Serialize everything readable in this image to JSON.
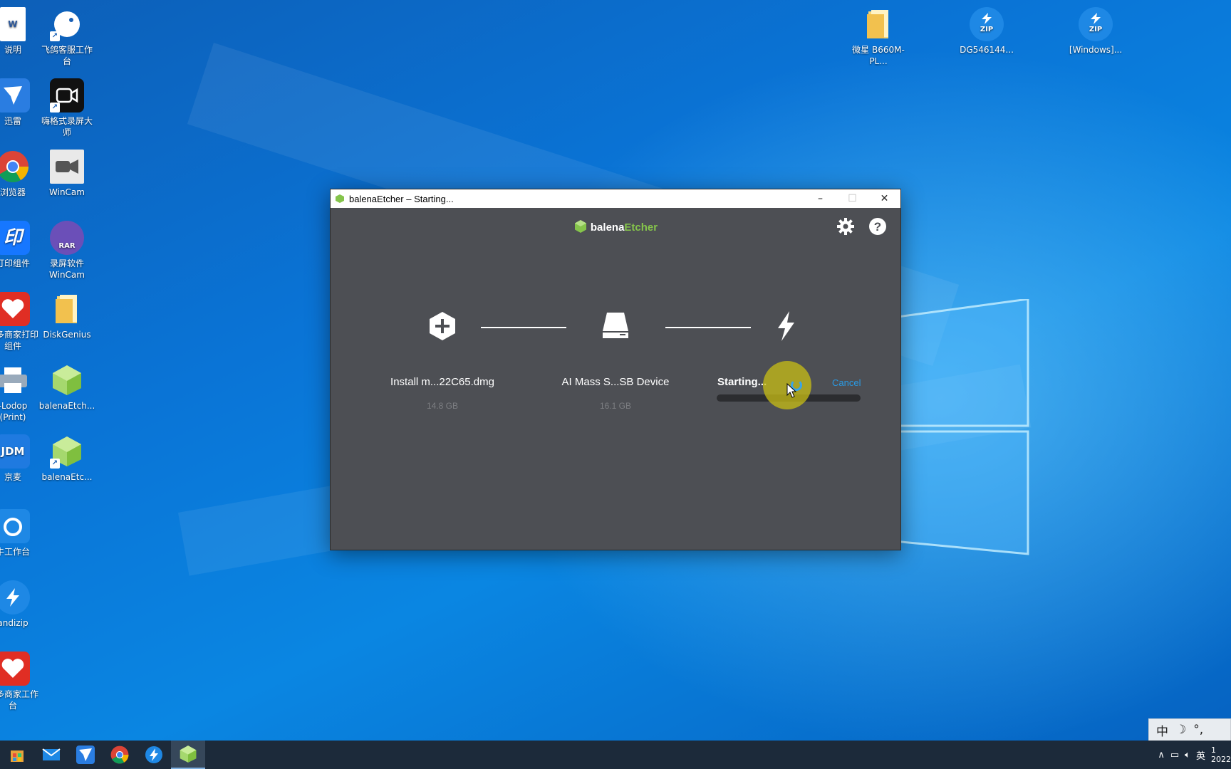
{
  "desktop": {
    "left_icons": [
      {
        "label": "说明"
      },
      {
        "label": "飞鸽客服工作台"
      },
      {
        "label": "迅雷"
      },
      {
        "label": "嗨格式录屏大师"
      },
      {
        "label": "浏览器"
      },
      {
        "label": "WinCam"
      },
      {
        "label": "打印组件"
      },
      {
        "label": "录屏软件 WinCam"
      },
      {
        "label": "多多商家打印组件"
      },
      {
        "label": "DiskGenius"
      },
      {
        "label": "-Lodop (Print)"
      },
      {
        "label": "balenaEtch..."
      },
      {
        "label": "京麦"
      },
      {
        "label": "balenaEtc..."
      },
      {
        "label": "牛工作台"
      },
      {
        "label": "andizip"
      },
      {
        "label": "多多商家工作台"
      }
    ],
    "top_right_icons": [
      {
        "label": "微星 B660M-PL..."
      },
      {
        "label": "DG546144..."
      },
      {
        "label": "[Windows]..."
      }
    ],
    "zip_badge": "ZIP",
    "rar_badge": "RAR",
    "jdm_badge": "JDM",
    "word_badge": "W"
  },
  "window": {
    "title": "balenaEtcher – Starting...",
    "brand_prefix": "balena",
    "brand_accent": "Etcher",
    "accent_color": "#85c44b",
    "steps": {
      "source_name": "Install m...22C65.dmg",
      "source_size": "14.8 GB",
      "target_name": "AI Mass S...SB Device",
      "target_size": "16.1 GB"
    },
    "status_text": "Starting...",
    "cancel_label": "Cancel",
    "progress": 0
  },
  "ime": {
    "chars": [
      "中",
      "☽",
      "°,"
    ]
  },
  "taskbar": {
    "apps": [
      "store-icon",
      "mail-icon",
      "thunder-icon",
      "chrome-icon",
      "bandizip-icon",
      "balena-etcher-icon"
    ],
    "tray_lang": "英",
    "clock_partial": "1",
    "date_partial": "2022"
  }
}
